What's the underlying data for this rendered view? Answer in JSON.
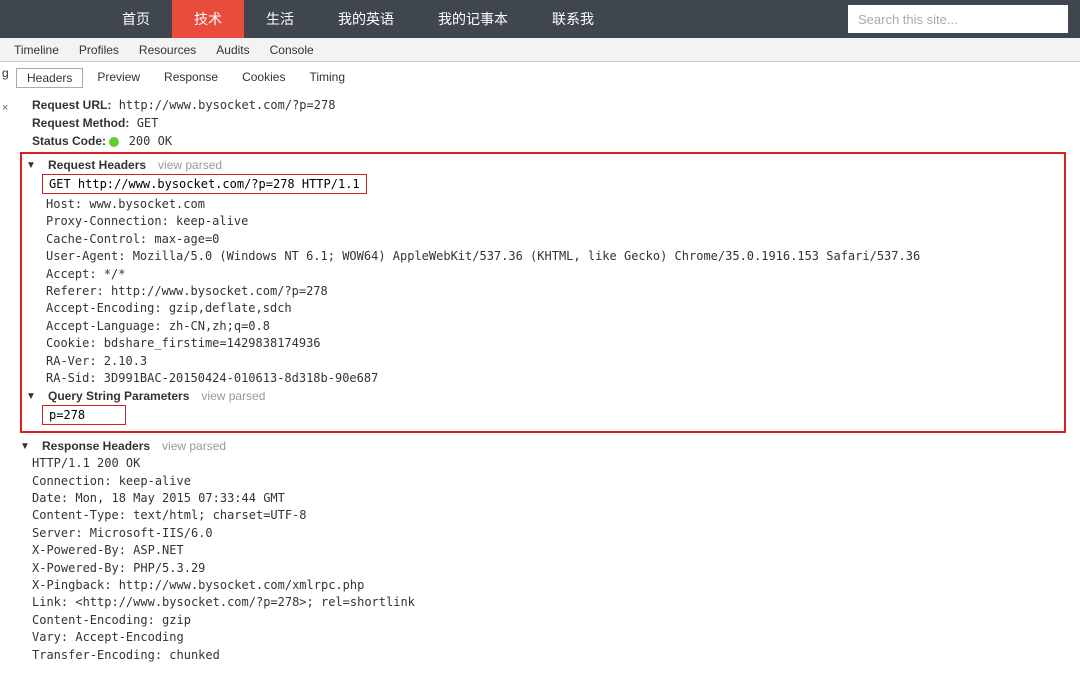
{
  "nav": {
    "items": [
      "首页",
      "技术",
      "生活",
      "我的英语",
      "我的记事本",
      "联系我"
    ],
    "search_placeholder": "Search this site..."
  },
  "devtools_tabs": [
    "Timeline",
    "Profiles",
    "Resources",
    "Audits",
    "Console"
  ],
  "marker": "g",
  "header_tabs": [
    "Headers",
    "Preview",
    "Response",
    "Cookies",
    "Timing"
  ],
  "general": {
    "url_label": "Request URL:",
    "url_value": "http://www.bysocket.com/?p=278",
    "method_label": "Request Method:",
    "method_value": "GET",
    "status_label": "Status Code:",
    "status_value": "200 OK"
  },
  "request_headers": {
    "title": "Request Headers",
    "view_parsed": "view parsed",
    "first_line": "GET http://www.bysocket.com/?p=278 HTTP/1.1",
    "lines": [
      "Host: www.bysocket.com",
      "Proxy-Connection: keep-alive",
      "Cache-Control: max-age=0",
      "User-Agent: Mozilla/5.0 (Windows NT 6.1; WOW64) AppleWebKit/537.36 (KHTML, like Gecko) Chrome/35.0.1916.153 Safari/537.36",
      "Accept: */*",
      "Referer: http://www.bysocket.com/?p=278",
      "Accept-Encoding: gzip,deflate,sdch",
      "Accept-Language: zh-CN,zh;q=0.8",
      "Cookie: bdshare_firstime=1429838174936",
      "RA-Ver: 2.10.3",
      "RA-Sid: 3D991BAC-20150424-010613-8d318b-90e687"
    ]
  },
  "query_string": {
    "title": "Query String Parameters",
    "view_parsed": "view parsed",
    "line": "p=278"
  },
  "response_headers": {
    "title": "Response Headers",
    "view_parsed": "view parsed",
    "lines": [
      "HTTP/1.1 200 OK",
      "Connection: keep-alive",
      "Date: Mon, 18 May 2015 07:33:44 GMT",
      "Content-Type: text/html; charset=UTF-8",
      "Server: Microsoft-IIS/6.0",
      "X-Powered-By: ASP.NET",
      "X-Powered-By: PHP/5.3.29",
      "X-Pingback: http://www.bysocket.com/xmlrpc.php",
      "Link: <http://www.bysocket.com/?p=278>; rel=shortlink",
      "Content-Encoding: gzip",
      "Vary: Accept-Encoding",
      "Transfer-Encoding: chunked"
    ]
  }
}
